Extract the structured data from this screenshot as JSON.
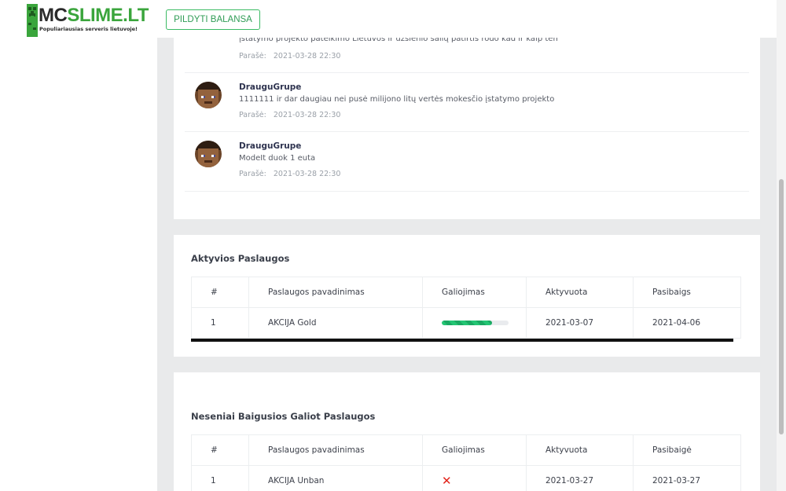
{
  "header": {
    "logo_mc": "MC",
    "logo_slime": "SLIME.LT",
    "logo_tagline": "Populiariausias serveris lietuvoje!",
    "topup_label": "PILDYTI BALANSA"
  },
  "comments": [
    {
      "author": "",
      "text": "įstatymo projekto pateikimo Lietuvos ir užsienio šalių patirtis rodo kad ir kaip ten",
      "meta_label": "Parašė:",
      "date": "2021-03-28 22:30"
    },
    {
      "author": "DrauguGrupe",
      "text": "1111111 ir dar daugiau nei pusė milijono litų vertės mokesčio įstatymo projekto",
      "meta_label": "Parašė:",
      "date": "2021-03-28 22:30"
    },
    {
      "author": "DrauguGrupe",
      "text": "ModeIt duok 1 euta",
      "meta_label": "Parašė:",
      "date": "2021-03-28 22:30"
    }
  ],
  "active_services": {
    "title": "Aktyvios Paslaugos",
    "columns": [
      "#",
      "Paslaugos pavadinimas",
      "Galiojimas",
      "Aktyvuota",
      "Pasibaigs"
    ],
    "rows": [
      {
        "num": "1",
        "name": "AKCIJA Gold",
        "validity_progress": 0.75,
        "activated": "2021-03-07",
        "ends": "2021-04-06"
      }
    ]
  },
  "expired_services": {
    "title": "Neseniai Baigusios Galiot Paslaugos",
    "columns": [
      "#",
      "Paslaugos pavadinimas",
      "Galiojimas",
      "Aktyvuota",
      "Pasibaigė"
    ],
    "rows": [
      {
        "num": "1",
        "name": "AKCIJA Unban",
        "validity_icon": "x-mark-icon",
        "validity_glyph": "✕",
        "activated": "2021-03-27",
        "ended": "2021-03-27"
      }
    ]
  },
  "colors": {
    "accent_green": "#3bbb64",
    "progress_green": "#23c573",
    "expired_red": "#e2231a",
    "page_background": "#e9eaeb"
  }
}
